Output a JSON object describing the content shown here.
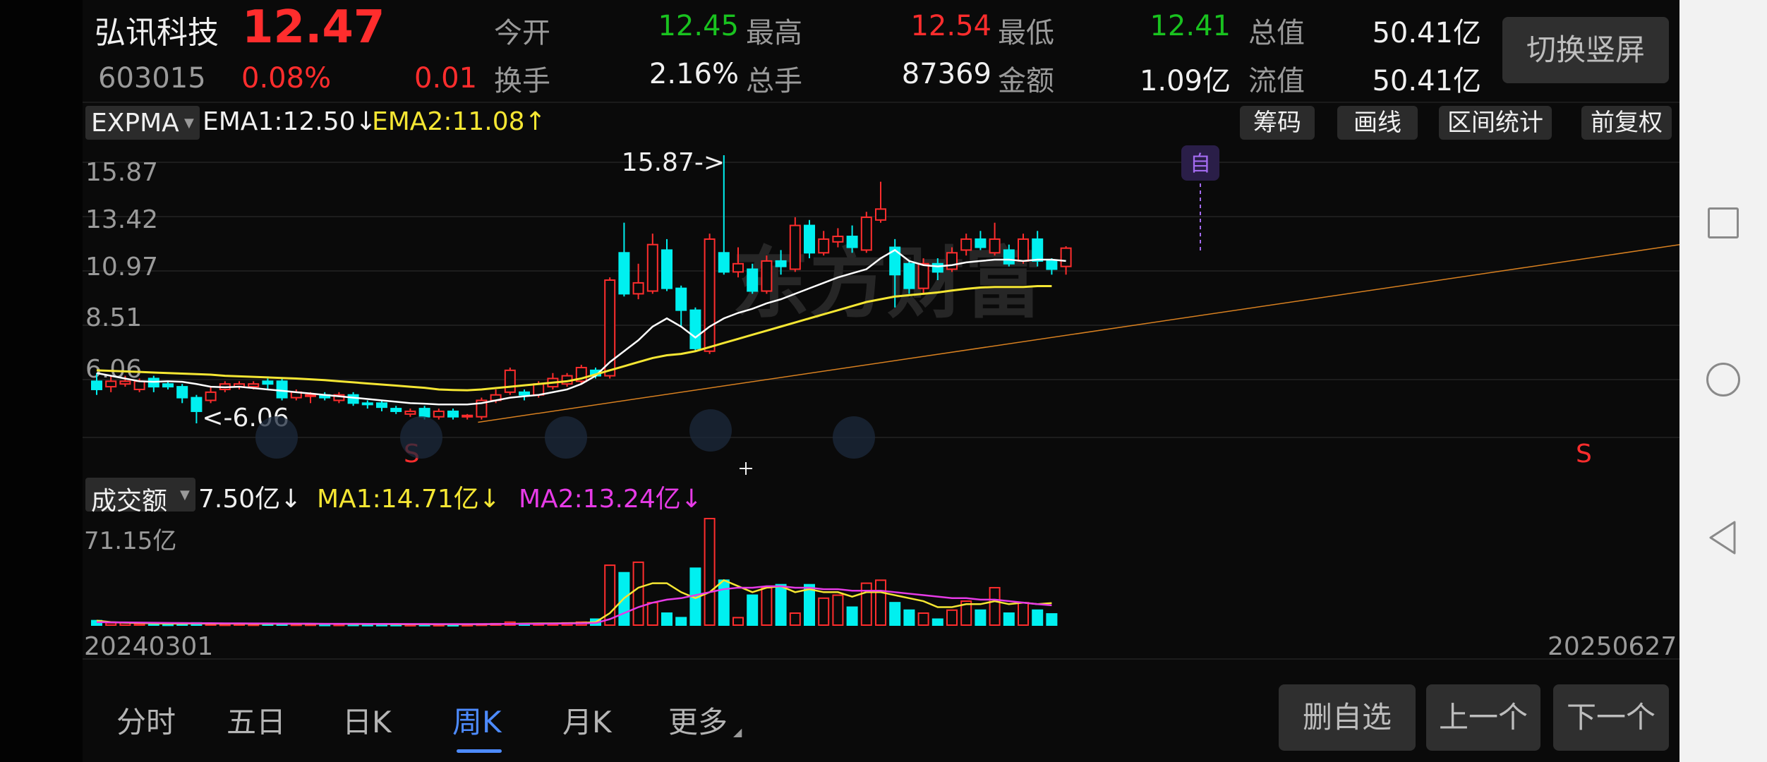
{
  "stock": {
    "name": "弘讯科技",
    "price": "12.47",
    "code": "603015",
    "change_pct": "0.08%",
    "change": "0.01"
  },
  "quote": {
    "open_label": "今开",
    "open": "12.45",
    "high_label": "最高",
    "high": "12.54",
    "low_label": "最低",
    "low": "12.41",
    "mcap_label": "总值",
    "mcap": "50.41亿",
    "turnover_label": "换手",
    "turnover": "2.16%",
    "volume_label": "总手",
    "volume": "87369",
    "amount_label": "金额",
    "amount": "1.09亿",
    "float_label": "流值",
    "float": "50.41亿"
  },
  "switch_button": "切换竖屏",
  "indicator": {
    "name": "EXPMA",
    "ema1": "EMA1:12.50↓",
    "ema2": "EMA2:11.08↑"
  },
  "toolbar": {
    "chips": "筹码",
    "draw": "画线",
    "range_stats": "区间统计",
    "adjust": "前复权"
  },
  "price_axis": [
    "15.87",
    "13.42",
    "10.97",
    "8.51",
    "6.06"
  ],
  "annotations": {
    "high": "15.87->",
    "low": "<-6.06",
    "zi": "自",
    "sell1": "S",
    "sell2": "S"
  },
  "watermark": "东方财富",
  "volume_indicator": {
    "name": "成交额",
    "value": "7.50亿↓",
    "ma1": "MA1:14.71亿↓",
    "ma2": "MA2:13.24亿↓",
    "axis_max": "71.15亿"
  },
  "dates": {
    "start": "20240301",
    "end": "20250627"
  },
  "tabs": [
    "分时",
    "五日",
    "日K",
    "周K",
    "月K",
    "更多"
  ],
  "active_tab": 3,
  "actions": {
    "delete": "删自选",
    "prev": "上一个",
    "next": "下一个"
  },
  "colors": {
    "up": "#ff2d2d",
    "down": "#00f0f0",
    "ema1": "#ffffff",
    "ema2": "#f5e633",
    "ma2": "#e63be6",
    "active_tab": "#4d8bff"
  },
  "chart_data": {
    "type": "candlestick",
    "candles": [
      {
        "o": 7.6,
        "c": 7.3,
        "h": 7.9,
        "l": 7.1
      },
      {
        "o": 7.4,
        "c": 7.6,
        "h": 7.8,
        "l": 7.2
      },
      {
        "o": 7.5,
        "c": 7.6,
        "h": 7.8,
        "l": 7.4
      },
      {
        "o": 7.3,
        "c": 7.6,
        "h": 7.7,
        "l": 7.2
      },
      {
        "o": 7.7,
        "c": 7.4,
        "h": 7.8,
        "l": 7.2
      },
      {
        "o": 7.5,
        "c": 7.4,
        "h": 7.6,
        "l": 7.3
      },
      {
        "o": 7.4,
        "c": 7.0,
        "h": 7.5,
        "l": 6.8
      },
      {
        "o": 7.0,
        "c": 6.5,
        "h": 7.1,
        "l": 6.06
      },
      {
        "o": 6.9,
        "c": 7.2,
        "h": 7.4,
        "l": 6.8
      },
      {
        "o": 7.3,
        "c": 7.5,
        "h": 7.6,
        "l": 7.2
      },
      {
        "o": 7.4,
        "c": 7.5,
        "h": 7.6,
        "l": 7.3
      },
      {
        "o": 7.4,
        "c": 7.5,
        "h": 7.6,
        "l": 7.3
      },
      {
        "o": 7.6,
        "c": 7.5,
        "h": 7.7,
        "l": 7.3
      },
      {
        "o": 7.6,
        "c": 7.0,
        "h": 7.7,
        "l": 6.9
      },
      {
        "o": 7.0,
        "c": 7.2,
        "h": 7.3,
        "l": 6.9
      },
      {
        "o": 7.1,
        "c": 7.1,
        "h": 7.2,
        "l": 6.8
      },
      {
        "o": 7.1,
        "c": 7.0,
        "h": 7.2,
        "l": 6.9
      },
      {
        "o": 6.9,
        "c": 7.1,
        "h": 7.2,
        "l": 6.8
      },
      {
        "o": 7.1,
        "c": 6.8,
        "h": 7.2,
        "l": 6.7
      },
      {
        "o": 6.8,
        "c": 6.75,
        "h": 6.9,
        "l": 6.6
      },
      {
        "o": 6.8,
        "c": 6.65,
        "h": 6.9,
        "l": 6.5
      },
      {
        "o": 6.6,
        "c": 6.5,
        "h": 6.7,
        "l": 6.4
      },
      {
        "o": 6.4,
        "c": 6.5,
        "h": 6.6,
        "l": 6.3
      },
      {
        "o": 6.6,
        "c": 6.3,
        "h": 6.7,
        "l": 6.2
      },
      {
        "o": 6.3,
        "c": 6.5,
        "h": 6.6,
        "l": 6.2
      },
      {
        "o": 6.5,
        "c": 6.3,
        "h": 6.6,
        "l": 6.2
      },
      {
        "o": 6.3,
        "c": 6.35,
        "h": 6.4,
        "l": 6.2
      },
      {
        "o": 6.3,
        "c": 6.9,
        "h": 7.0,
        "l": 6.2
      },
      {
        "o": 6.9,
        "c": 7.1,
        "h": 7.3,
        "l": 6.8
      },
      {
        "o": 7.2,
        "c": 8.0,
        "h": 8.1,
        "l": 7.1
      },
      {
        "o": 7.2,
        "c": 7.1,
        "h": 7.3,
        "l": 6.9
      },
      {
        "o": 7.1,
        "c": 7.5,
        "h": 7.6,
        "l": 7.0
      },
      {
        "o": 7.4,
        "c": 7.7,
        "h": 7.9,
        "l": 7.3
      },
      {
        "o": 7.5,
        "c": 7.8,
        "h": 7.9,
        "l": 7.4
      },
      {
        "o": 7.6,
        "c": 8.1,
        "h": 8.2,
        "l": 7.5
      },
      {
        "o": 8.0,
        "c": 7.8,
        "h": 8.1,
        "l": 7.7
      },
      {
        "o": 7.8,
        "c": 11.3,
        "h": 11.4,
        "l": 7.7
      },
      {
        "o": 12.3,
        "c": 10.8,
        "h": 13.4,
        "l": 10.7
      },
      {
        "o": 10.8,
        "c": 11.2,
        "h": 11.9,
        "l": 10.6
      },
      {
        "o": 10.9,
        "c": 12.6,
        "h": 13.0,
        "l": 10.8
      },
      {
        "o": 12.4,
        "c": 11.0,
        "h": 12.8,
        "l": 10.9
      },
      {
        "o": 11.0,
        "c": 10.2,
        "h": 11.1,
        "l": 9.6
      },
      {
        "o": 10.2,
        "c": 8.8,
        "h": 10.3,
        "l": 8.7
      },
      {
        "o": 8.7,
        "c": 12.8,
        "h": 13.0,
        "l": 8.6
      },
      {
        "o": 12.3,
        "c": 11.6,
        "h": 15.87,
        "l": 11.5
      },
      {
        "o": 11.6,
        "c": 11.9,
        "h": 12.5,
        "l": 11.4
      },
      {
        "o": 11.7,
        "c": 10.9,
        "h": 11.9,
        "l": 10.8
      },
      {
        "o": 10.9,
        "c": 12.0,
        "h": 12.2,
        "l": 10.8
      },
      {
        "o": 12.0,
        "c": 11.8,
        "h": 12.4,
        "l": 11.5
      },
      {
        "o": 11.7,
        "c": 13.3,
        "h": 13.6,
        "l": 11.6
      },
      {
        "o": 13.3,
        "c": 12.3,
        "h": 13.5,
        "l": 12.1
      },
      {
        "o": 12.3,
        "c": 12.8,
        "h": 13.1,
        "l": 12.2
      },
      {
        "o": 12.7,
        "c": 12.9,
        "h": 13.2,
        "l": 12.5
      },
      {
        "o": 12.9,
        "c": 12.5,
        "h": 13.3,
        "l": 12.3
      },
      {
        "o": 12.4,
        "c": 13.6,
        "h": 13.8,
        "l": 12.3
      },
      {
        "o": 13.5,
        "c": 13.9,
        "h": 14.9,
        "l": 13.4
      },
      {
        "o": 12.5,
        "c": 11.5,
        "h": 12.8,
        "l": 10.3
      },
      {
        "o": 11.9,
        "c": 11.0,
        "h": 12.0,
        "l": 10.8
      },
      {
        "o": 11.0,
        "c": 11.9,
        "h": 12.1,
        "l": 10.8
      },
      {
        "o": 11.9,
        "c": 11.6,
        "h": 12.1,
        "l": 11.3
      },
      {
        "o": 11.7,
        "c": 12.3,
        "h": 12.5,
        "l": 11.6
      },
      {
        "o": 12.4,
        "c": 12.8,
        "h": 13.0,
        "l": 12.2
      },
      {
        "o": 12.8,
        "c": 12.5,
        "h": 13.1,
        "l": 12.4
      },
      {
        "o": 12.3,
        "c": 12.8,
        "h": 13.4,
        "l": 12.2
      },
      {
        "o": 12.4,
        "c": 11.9,
        "h": 12.6,
        "l": 11.8
      },
      {
        "o": 12.0,
        "c": 12.8,
        "h": 13.0,
        "l": 11.9
      },
      {
        "o": 12.8,
        "c": 12.0,
        "h": 13.1,
        "l": 11.8
      },
      {
        "o": 12.0,
        "c": 11.7,
        "h": 12.1,
        "l": 11.5
      },
      {
        "o": 11.8,
        "c": 12.47,
        "h": 12.54,
        "l": 11.5
      }
    ],
    "ema1": [
      7.9,
      7.8,
      7.7,
      7.6,
      7.58,
      7.6,
      7.58,
      7.5,
      7.4,
      7.38,
      7.4,
      7.35,
      7.3,
      7.25,
      7.2,
      7.15,
      7.1,
      7.05,
      7.0,
      6.95,
      6.9,
      6.85,
      6.8,
      6.78,
      6.75,
      6.75,
      6.75,
      6.8,
      6.9,
      7.0,
      7.05,
      7.1,
      7.2,
      7.3,
      7.5,
      7.8,
      8.3,
      8.7,
      9.1,
      9.6,
      9.9,
      9.6,
      9.2,
      9.6,
      9.9,
      10.1,
      10.25,
      10.45,
      10.6,
      10.8,
      11.0,
      11.2,
      11.4,
      11.55,
      11.7,
      12.1,
      12.4,
      12.0,
      11.85,
      11.8,
      11.85,
      11.95,
      12.0,
      12.05,
      12.05,
      12.0,
      12.05,
      12.05,
      12.0
    ],
    "ema2": [
      8.0,
      7.98,
      7.96,
      7.94,
      7.92,
      7.9,
      7.88,
      7.86,
      7.84,
      7.8,
      7.78,
      7.76,
      7.74,
      7.72,
      7.7,
      7.67,
      7.64,
      7.6,
      7.56,
      7.52,
      7.48,
      7.44,
      7.4,
      7.36,
      7.3,
      7.28,
      7.27,
      7.3,
      7.35,
      7.4,
      7.45,
      7.5,
      7.55,
      7.6,
      7.7,
      7.85,
      8.0,
      8.15,
      8.3,
      8.45,
      8.55,
      8.6,
      8.7,
      8.85,
      9.0,
      9.15,
      9.3,
      9.45,
      9.6,
      9.75,
      9.9,
      10.05,
      10.2,
      10.35,
      10.5,
      10.6,
      10.7,
      10.75,
      10.8,
      10.85,
      10.92,
      10.98,
      11.03,
      11.05,
      11.05,
      11.05,
      11.08,
      11.08
    ],
    "volume": [
      3,
      1.5,
      1.5,
      1,
      1,
      0.8,
      1,
      1.5,
      1,
      0.8,
      1,
      0.8,
      1,
      1,
      0.8,
      0.8,
      0.7,
      0.7,
      0.7,
      0.6,
      0.6,
      0.6,
      0.5,
      0.6,
      0.5,
      0.5,
      0.5,
      0.8,
      1,
      2,
      1,
      1.2,
      1.2,
      1.5,
      2,
      4,
      40,
      35,
      42,
      15,
      8,
      5,
      38,
      71.15,
      30,
      5,
      20,
      25,
      27,
      8,
      27,
      18,
      20,
      12,
      28,
      30,
      15,
      10,
      8,
      4,
      10,
      16,
      10,
      25,
      8,
      15,
      10,
      7.5
    ],
    "vol_ma1": [
      3,
      2,
      1.6,
      1.4,
      1.2,
      1,
      1,
      1.1,
      1,
      1,
      1,
      0.9,
      0.9,
      0.9,
      0.9,
      0.8,
      0.8,
      0.8,
      0.7,
      0.7,
      0.7,
      0.6,
      0.6,
      0.6,
      0.55,
      0.55,
      0.55,
      0.6,
      0.7,
      0.9,
      1,
      1.1,
      1.2,
      1.3,
      1.5,
      2,
      8,
      18,
      25,
      28,
      28,
      22,
      18,
      22,
      30,
      26,
      22,
      25,
      26,
      22,
      24,
      22,
      22,
      19,
      22,
      22,
      20,
      18,
      16,
      12,
      12,
      14,
      14,
      16,
      14,
      15,
      14,
      14.71
    ],
    "vol_ma2": [
      2,
      1.9,
      1.8,
      1.7,
      1.6,
      1.5,
      1.4,
      1.3,
      1.3,
      1.2,
      1.2,
      1.1,
      1.1,
      1,
      1,
      1,
      0.9,
      0.9,
      0.9,
      0.85,
      0.8,
      0.8,
      0.75,
      0.75,
      0.7,
      0.7,
      0.7,
      0.7,
      0.75,
      0.8,
      0.85,
      0.9,
      1,
      1.1,
      1.2,
      1.4,
      4,
      8,
      12,
      15,
      17,
      18,
      20,
      22,
      24,
      25,
      25,
      26,
      26,
      25,
      25,
      24,
      24,
      23,
      23,
      23,
      22,
      21,
      20,
      19,
      18,
      18,
      17,
      17,
      16,
      15,
      14,
      13.24
    ],
    "ylim": [
      6.06,
      15.87
    ]
  }
}
